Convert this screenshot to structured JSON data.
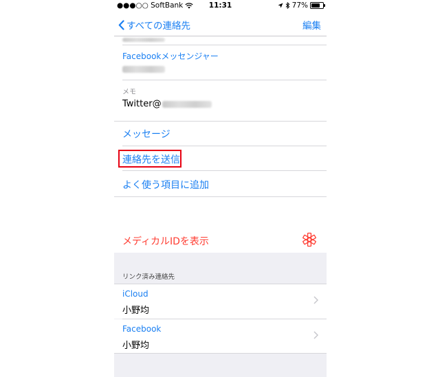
{
  "status_bar": {
    "carrier": "●●●○○ SoftBank",
    "time": "11:31",
    "battery_label": "77%",
    "battery_level": 0.77
  },
  "nav": {
    "back_label": "すべての連絡先",
    "edit_label": "編集"
  },
  "fields": [
    {
      "label": "Facebookメッセンジャー"
    },
    {
      "label": "メモ",
      "value_prefix": "Twitter@"
    }
  ],
  "actions": {
    "message": "メッセージ",
    "send_contact": "連絡先を送信",
    "add_favorite": "よく使う項目に追加"
  },
  "medical": {
    "label": "メディカルIDを表示"
  },
  "linked": {
    "header": "リンク済み連絡先",
    "items": [
      {
        "source": "iCloud",
        "name": "小野均"
      },
      {
        "source": "Facebook",
        "name": "小野均"
      }
    ]
  },
  "colors": {
    "accent": "#1a7ff2",
    "danger": "#ff3b30",
    "highlight_box": "#e60012",
    "section_bg": "#efeff4"
  }
}
